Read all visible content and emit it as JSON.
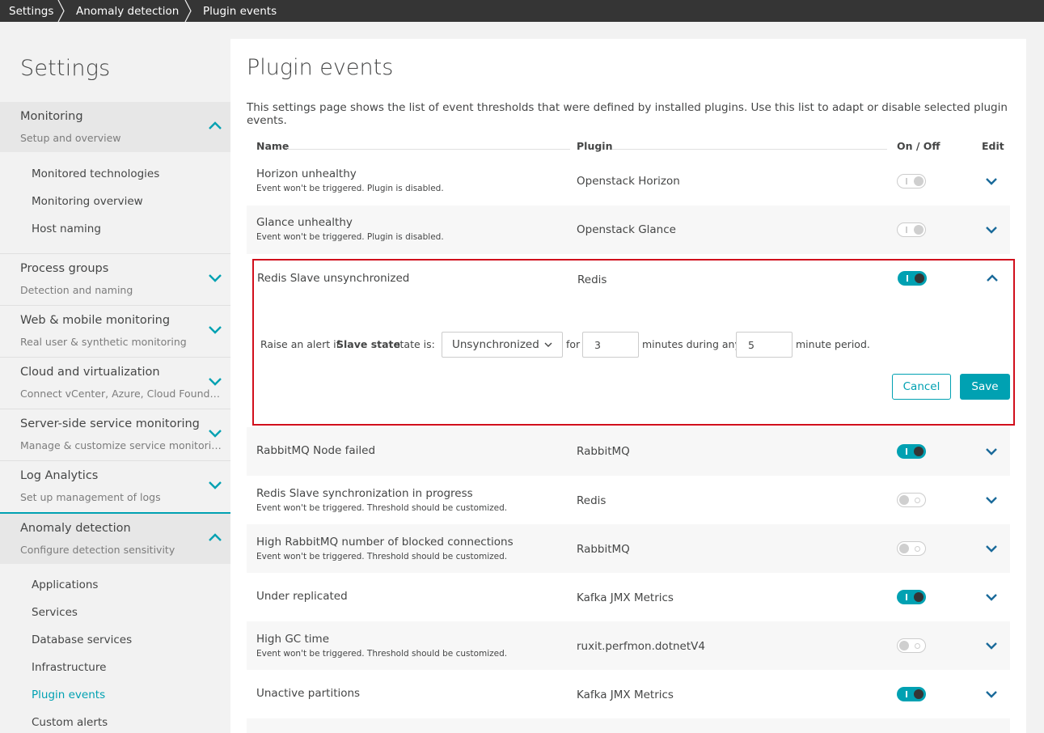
{
  "breadcrumb": {
    "items": [
      "Settings",
      "Anomaly detection",
      "Plugin events"
    ]
  },
  "sidebar": {
    "title": "Settings",
    "sections": [
      {
        "title": "Monitoring",
        "subtitle": "Setup and overview",
        "expanded": true,
        "items": [
          "Monitored technologies",
          "Monitoring overview",
          "Host naming"
        ]
      },
      {
        "title": "Process groups",
        "subtitle": "Detection and naming",
        "expanded": false
      },
      {
        "title": "Web & mobile monitoring",
        "subtitle": "Real user & synthetic monitoring",
        "expanded": false
      },
      {
        "title": "Cloud and virtualization",
        "subtitle": "Connect vCenter, Azure, Cloud Foundry o...",
        "expanded": false
      },
      {
        "title": "Server-side service monitoring",
        "subtitle": "Manage & customize service monitoring",
        "expanded": false
      },
      {
        "title": "Log Analytics",
        "subtitle": "Set up management of logs",
        "expanded": false
      },
      {
        "title": "Anomaly detection",
        "subtitle": "Configure detection sensitivity",
        "expanded": true,
        "items": [
          "Applications",
          "Services",
          "Database services",
          "Infrastructure",
          "Plugin events",
          "Custom alerts"
        ],
        "active_item": "Plugin events"
      }
    ]
  },
  "main": {
    "title": "Plugin events",
    "description": "This settings page shows the list of event thresholds that were defined by installed plugins. Use this list to adapt or disable selected plugin events.",
    "columns": {
      "name": "Name",
      "plugin": "Plugin",
      "onoff": "On / Off",
      "edit": "Edit"
    },
    "rows": [
      {
        "name": "Horizon unhealthy",
        "note": "Event won't be triggered. Plugin is disabled.",
        "plugin": "Openstack Horizon",
        "state": "disabled-on"
      },
      {
        "name": "Glance unhealthy",
        "note": "Event won't be triggered. Plugin is disabled.",
        "plugin": "Openstack Glance",
        "state": "disabled-on"
      },
      {
        "name": "Redis Slave unsynchronized",
        "note": "",
        "plugin": "Redis",
        "state": "on",
        "expanded": true
      },
      {
        "name": "RabbitMQ Node failed",
        "note": "",
        "plugin": "RabbitMQ",
        "state": "on"
      },
      {
        "name": "Redis Slave synchronization in progress",
        "note": "Event won't be triggered. Threshold should be customized.",
        "plugin": "Redis",
        "state": "off"
      },
      {
        "name": "High RabbitMQ number of blocked connections",
        "note": "Event won't be triggered. Threshold should be customized.",
        "plugin": "RabbitMQ",
        "state": "off"
      },
      {
        "name": "Under replicated",
        "note": "",
        "plugin": "Kafka JMX Metrics",
        "state": "on"
      },
      {
        "name": "High GC time",
        "note": "Event won't be triggered. Threshold should be customized.",
        "plugin": "ruxit.perfmon.dotnetV4",
        "state": "off"
      },
      {
        "name": "Unactive partitions",
        "note": "",
        "plugin": "Kafka JMX Metrics",
        "state": "on"
      }
    ],
    "editor": {
      "prefix": "Raise an alert if",
      "metric": "Slave state",
      "middle": "state is:",
      "select_value": "Unsynchronized",
      "for_label": "for",
      "minutes_value": "3",
      "during_label": "minutes during any",
      "period_value": "5",
      "suffix": "minute period.",
      "cancel_label": "Cancel",
      "save_label": "Save"
    }
  },
  "colors": {
    "accent": "#00a1b2",
    "highlight_border": "#d10f1c",
    "topbar": "#353535"
  }
}
